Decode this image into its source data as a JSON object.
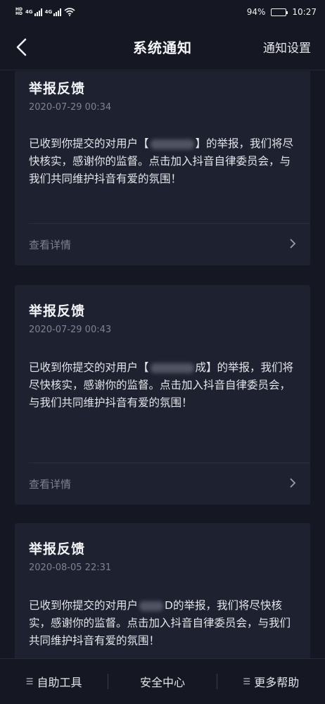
{
  "status_bar": {
    "battery_text": "94%",
    "battery_level": 0.94,
    "time": "10:27",
    "sim1_label": "4G",
    "sim2_label": "4G",
    "hd1": "HD",
    "hd2": "HD"
  },
  "nav": {
    "back_icon": "chevron-left-icon",
    "title": "系统通知",
    "settings_label": "通知设置"
  },
  "notifications": [
    {
      "title": "举报反馈",
      "time": "2020-07-29 00:34",
      "body_prefix": "已收到你提交的对用户【",
      "body_suffix": "】的举报，我们将尽快核实，感谢你的监督。点击加入抖音自律委员会，与我们共同维护抖音有爱的氛围！",
      "link_label": "查看详情"
    },
    {
      "title": "举报反馈",
      "time": "2020-07-29 00:43",
      "body_prefix": "已收到你提交的对用户【",
      "body_suffix": "成】的举报，我们将尽快核实，感谢你的监督。点击加入抖音自律委员会，与我们共同维护抖音有爱的氛围！",
      "link_label": "查看详情"
    },
    {
      "title": "举报反馈",
      "time": "2020-08-05 22:31",
      "body_prefix": "已收到你提交的对用户",
      "body_suffix": "D的举报，我们将尽快核实，感谢你的监督。点击加入抖音自律委员会，与我们共同维护抖音有爱的氛围！",
      "link_label": ""
    }
  ],
  "bottom_bar": {
    "tools": [
      {
        "label": "自助工具",
        "icon": "menu-icon"
      },
      {
        "label": "安全中心",
        "icon": ""
      },
      {
        "label": "更多帮助",
        "icon": "menu-icon"
      }
    ]
  },
  "colors": {
    "background": "#151722",
    "card": "#1e2130",
    "muted_text": "#7e8292",
    "primary_text": "#e9eaee"
  }
}
